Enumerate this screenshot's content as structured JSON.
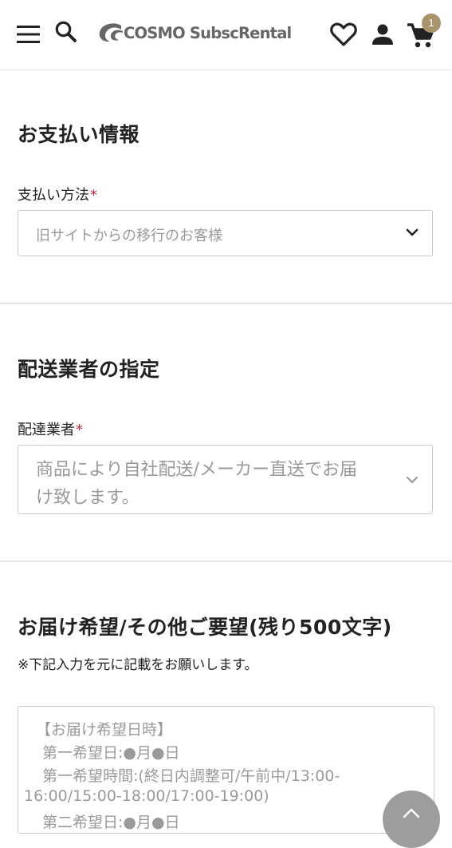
{
  "header": {
    "logo_text": "COSMO SubscRental",
    "cart_count": "1",
    "icons": [
      "menu-icon",
      "search-icon",
      "logo-mark",
      "heart-icon",
      "account-icon",
      "cart-icon"
    ]
  },
  "payment": {
    "title": "お支払い情報",
    "label": "支払い方法",
    "required_mark": "*",
    "selected": "旧サイトからの移行のお客様"
  },
  "carrier": {
    "title": "配送業者の指定",
    "label": "配達業者",
    "required_mark": "*",
    "selected_line1": "商品により自社配送/メーカー直送でお届",
    "selected_line2": "け致します。"
  },
  "request": {
    "title": "お届け希望/その他ご要望(残り500文字)",
    "note": "※下記入力を元に記載をお願いします。",
    "placeholder_lines": [
      "【お届け希望日時】",
      "第一希望日:●月●日",
      "第一希望時間:(終日内調整可/午前中/13:00-",
      "16:00/15:00-18:00/17:00-19:00)",
      "第二希望日:●月●日"
    ]
  },
  "colors": {
    "required": "#d0253b",
    "badge": "#a8936b",
    "placeholder": "#9a9a9a",
    "border": "#c9c9c9"
  }
}
